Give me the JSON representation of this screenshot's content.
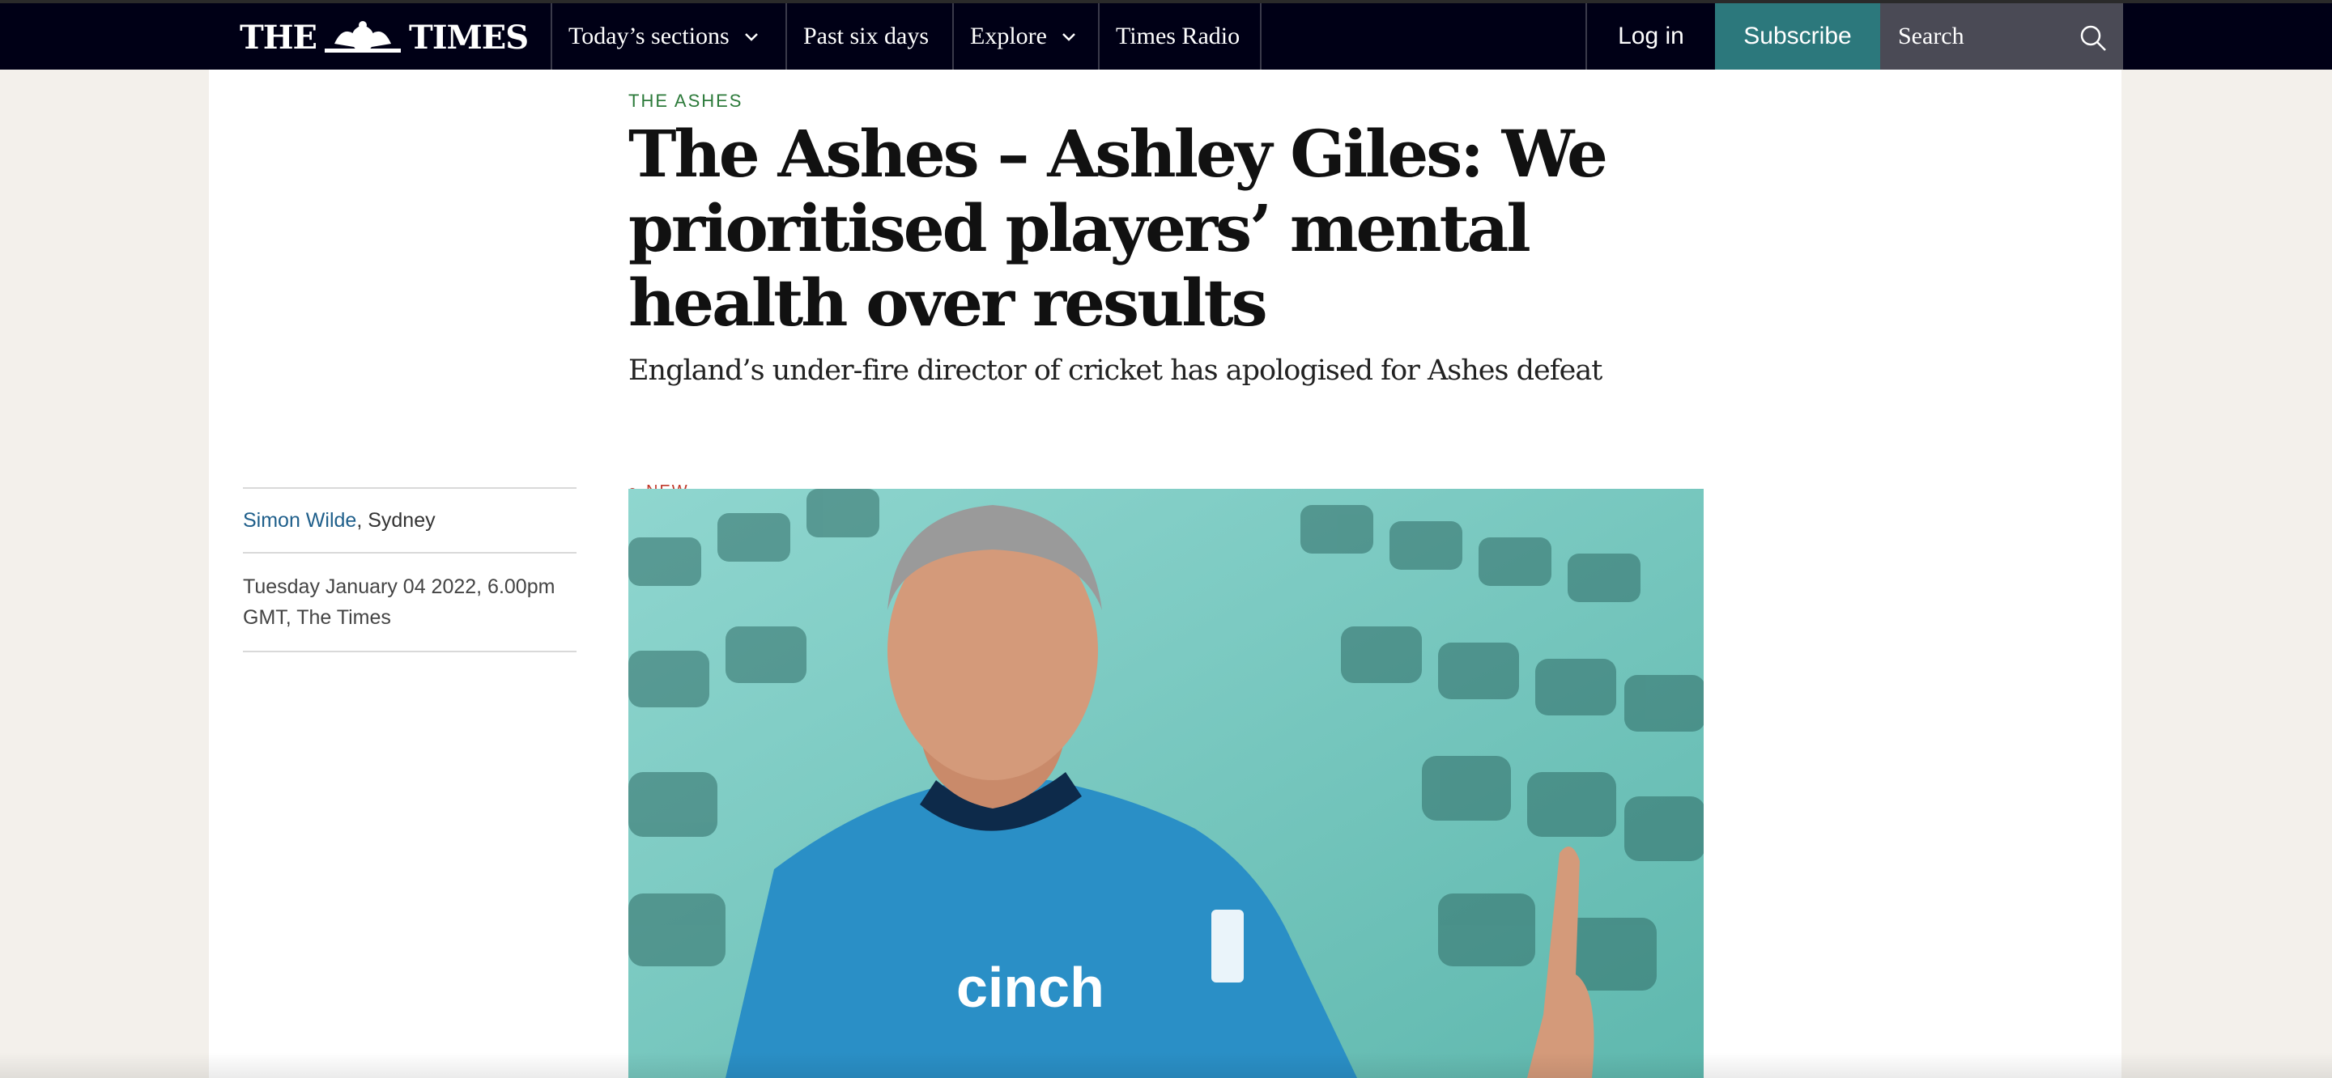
{
  "nav": {
    "brand_left": "THE",
    "brand_right": "TIMES",
    "items": [
      {
        "label": "Today’s sections",
        "has_dropdown": true
      },
      {
        "label": "Past six days",
        "has_dropdown": false
      },
      {
        "label": "Explore",
        "has_dropdown": true
      },
      {
        "label": "Times Radio",
        "has_dropdown": false
      }
    ],
    "login_label": "Log in",
    "subscribe_label": "Subscribe",
    "search_placeholder": "Search",
    "colors": {
      "bar": "#000016",
      "subscribe": "#2c787c",
      "search": "#4a4a55"
    }
  },
  "article": {
    "section": "THE ASHES",
    "headline": "The Ashes – Ashley Giles: We prioritised players’ mental health over results",
    "standfirst": "England’s under-fire director of cricket has apologised for Ashes defeat",
    "badge": "NEW",
    "author": "Simon Wilde",
    "location": ", Sydney",
    "dateline": "Tuesday January 04 2022, 6.00pm GMT, The Times",
    "image_icons": [
      "man-in-england-cricket-shirt",
      "stadium-seats"
    ],
    "image_shirt_sponsor": "cinch"
  }
}
